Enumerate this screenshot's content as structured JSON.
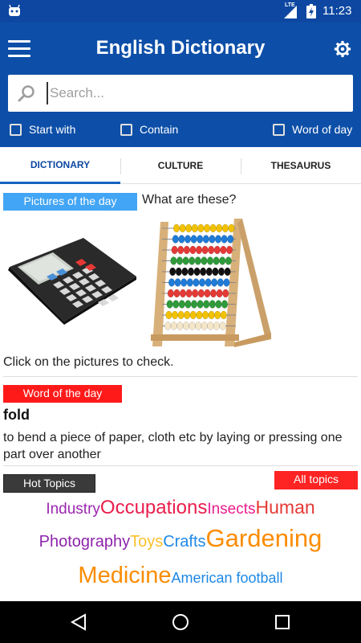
{
  "status": {
    "network": "LTE",
    "time": "11:23"
  },
  "app": {
    "title": "English Dictionary"
  },
  "search": {
    "placeholder": "Search...",
    "value": ""
  },
  "options": [
    {
      "label": "Start with",
      "checked": false
    },
    {
      "label": "Contain",
      "checked": false
    },
    {
      "label": "Word of day",
      "checked": false
    }
  ],
  "tabs": [
    {
      "label": "DICTIONARY",
      "active": true
    },
    {
      "label": "CULTURE",
      "active": false
    },
    {
      "label": "THESAURUS",
      "active": false
    }
  ],
  "pictures": {
    "label": "Pictures of the day",
    "question": "What are these?",
    "images": [
      "calculator",
      "abacus"
    ],
    "hint": "Click on the pictures to check."
  },
  "word_of_day": {
    "label": "Word of the day",
    "word": "fold",
    "definition": "to bend a piece of paper, cloth etc by laying or pressing one part over another"
  },
  "hot_topics": {
    "label": "Hot Topics",
    "all_label": "All topics",
    "lines": [
      [
        {
          "text": "Industry",
          "color": "#9c27b0"
        },
        {
          "text": "Occupations",
          "color": "#e91e4c"
        },
        {
          "text": "Insects",
          "color": "#e91e8c"
        },
        {
          "text": "Human",
          "color": "#e53935"
        }
      ],
      [
        {
          "text": "Photography",
          "color": "#8e24aa"
        },
        {
          "text": "Toys",
          "color": "#fbc02d"
        },
        {
          "text": "Crafts",
          "color": "#1e88e5"
        },
        {
          "text": "Gardening",
          "color": "#fb8c00"
        }
      ],
      [
        {
          "text": "Medicine",
          "color": "#fb8c00"
        },
        {
          "text": "American football",
          "color": "#1e88e5"
        }
      ]
    ]
  },
  "colors": {
    "primary": "#0d4fa8",
    "status": "#0d47a1",
    "pictures_label": "#42a5f5",
    "word_label": "#ff1a1a",
    "all_topics": "#ff2424"
  }
}
